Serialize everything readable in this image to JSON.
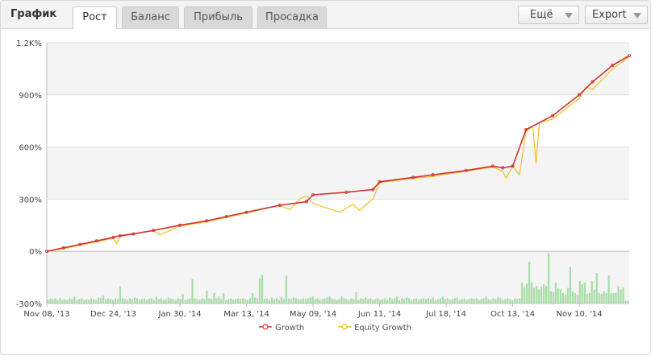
{
  "header": {
    "title": "График",
    "tabs": [
      {
        "label": "Рост",
        "active": true
      },
      {
        "label": "Баланс",
        "active": false
      },
      {
        "label": "Прибыль",
        "active": false
      },
      {
        "label": "Просадка",
        "active": false
      }
    ],
    "more_label": "Ещё",
    "export_label": "Export"
  },
  "colors": {
    "growth": "#cc3333",
    "equity": "#f0c020",
    "volume_bar": "#a8dca8",
    "band": "#f4f4f4"
  },
  "chart_data": {
    "type": "line",
    "title": "",
    "xlabel": "",
    "ylabel": "",
    "ylim": [
      -300,
      1200
    ],
    "y_ticks": [
      "-300%",
      "0%",
      "300%",
      "600%",
      "900%",
      "1.2K%"
    ],
    "y_tick_values": [
      -300,
      0,
      300,
      600,
      900,
      1200
    ],
    "x_ticks": [
      "Nov 08, '13",
      "Dec 24, '13",
      "Jan 30, '14",
      "Mar 13, '14",
      "May 09, '14",
      "Jun 11, '14",
      "Jul 18, '14",
      "Oct 13, '14",
      "Nov 10, '14"
    ],
    "x_tick_positions": [
      0,
      1,
      2,
      3,
      4,
      5,
      6,
      7,
      8
    ],
    "x_range": [
      0,
      8.75
    ],
    "legend": {
      "position": "bottom",
      "entries": [
        "Growth",
        "Equity Growth"
      ]
    },
    "grid": true,
    "series": [
      {
        "name": "Growth",
        "x": [
          0,
          0.25,
          0.5,
          0.75,
          1.0,
          1.1,
          1.3,
          1.6,
          2.0,
          2.4,
          2.7,
          3.0,
          3.5,
          3.9,
          4.0,
          4.5,
          4.9,
          5.0,
          5.5,
          5.8,
          6.3,
          6.7,
          6.85,
          7.0,
          7.2,
          7.6,
          8.0,
          8.2,
          8.5,
          8.75
        ],
        "values": [
          0,
          20,
          40,
          60,
          80,
          90,
          100,
          120,
          150,
          175,
          200,
          225,
          265,
          285,
          325,
          340,
          355,
          400,
          425,
          440,
          465,
          490,
          480,
          490,
          700,
          780,
          900,
          975,
          1070,
          1125
        ]
      },
      {
        "name": "Equity Growth",
        "x": [
          0,
          0.25,
          0.5,
          0.75,
          1.0,
          1.05,
          1.1,
          1.3,
          1.6,
          1.7,
          2.0,
          2.4,
          2.7,
          3.0,
          3.5,
          3.65,
          3.8,
          3.9,
          4.0,
          4.2,
          4.4,
          4.6,
          4.7,
          4.8,
          4.9,
          5.0,
          5.5,
          5.8,
          6.3,
          6.7,
          6.85,
          6.9,
          7.0,
          7.1,
          7.2,
          7.3,
          7.35,
          7.4,
          7.6,
          8.0,
          8.1,
          8.2,
          8.5,
          8.75
        ],
        "values": [
          0,
          15,
          35,
          55,
          75,
          45,
          85,
          100,
          120,
          95,
          145,
          170,
          195,
          220,
          265,
          240,
          300,
          320,
          275,
          250,
          225,
          270,
          235,
          270,
          300,
          395,
          420,
          430,
          460,
          485,
          460,
          420,
          490,
          440,
          690,
          720,
          505,
          740,
          760,
          880,
          945,
          930,
          1050,
          1120
        ]
      }
    ],
    "volume_bars": {
      "note": "secondary histogram, relative heights in data units of the -300..0 band",
      "values": [
        20,
        30,
        25,
        30,
        20,
        30,
        20,
        25,
        20,
        30,
        25,
        40,
        20,
        25,
        30,
        20,
        25,
        20,
        30,
        25,
        20,
        35,
        30,
        45,
        25,
        30,
        25,
        20,
        30,
        25,
        100,
        30,
        25,
        20,
        30,
        25,
        35,
        30,
        20,
        25,
        30,
        20,
        25,
        30,
        20,
        40,
        25,
        30,
        20,
        25,
        35,
        30,
        25,
        20,
        30,
        25,
        55,
        20,
        25,
        30,
        140,
        30,
        25,
        20,
        30,
        25,
        75,
        30,
        25,
        60,
        30,
        40,
        25,
        60,
        20,
        25,
        30,
        20,
        25,
        30,
        25,
        30,
        25,
        20,
        30,
        60,
        35,
        30,
        145,
        165,
        25,
        30,
        20,
        35,
        25,
        30,
        20,
        40,
        25,
        160,
        30,
        25,
        35,
        30,
        25,
        20,
        30,
        25,
        30,
        35,
        40,
        25,
        30,
        20,
        25,
        30,
        35,
        40,
        30,
        25,
        20,
        25,
        40,
        30,
        25,
        20,
        30,
        25,
        65,
        20,
        30,
        25,
        35,
        25,
        30,
        20,
        25,
        30,
        20,
        25,
        30,
        20,
        35,
        25,
        30,
        40,
        20,
        30,
        25,
        35,
        30,
        20,
        25,
        30,
        20,
        25,
        30,
        25,
        30,
        25,
        35,
        20,
        25,
        30,
        40,
        25,
        30,
        20,
        25,
        30,
        35,
        20,
        25,
        30,
        20,
        25,
        30,
        25,
        30,
        20,
        25,
        30,
        40,
        25,
        20,
        30,
        25,
        35,
        30,
        20,
        25,
        30,
        25,
        20,
        30,
        25,
        30,
        120,
        90,
        115,
        240,
        120,
        90,
        100,
        80,
        95,
        110,
        100,
        290,
        70,
        65,
        120,
        85,
        80,
        60,
        50,
        90,
        210,
        70,
        60,
        50,
        130,
        110,
        120,
        55,
        60,
        130,
        80,
        175,
        60,
        55,
        70,
        60,
        160,
        60,
        60,
        60,
        100,
        80,
        95,
        15,
        15
      ]
    }
  }
}
